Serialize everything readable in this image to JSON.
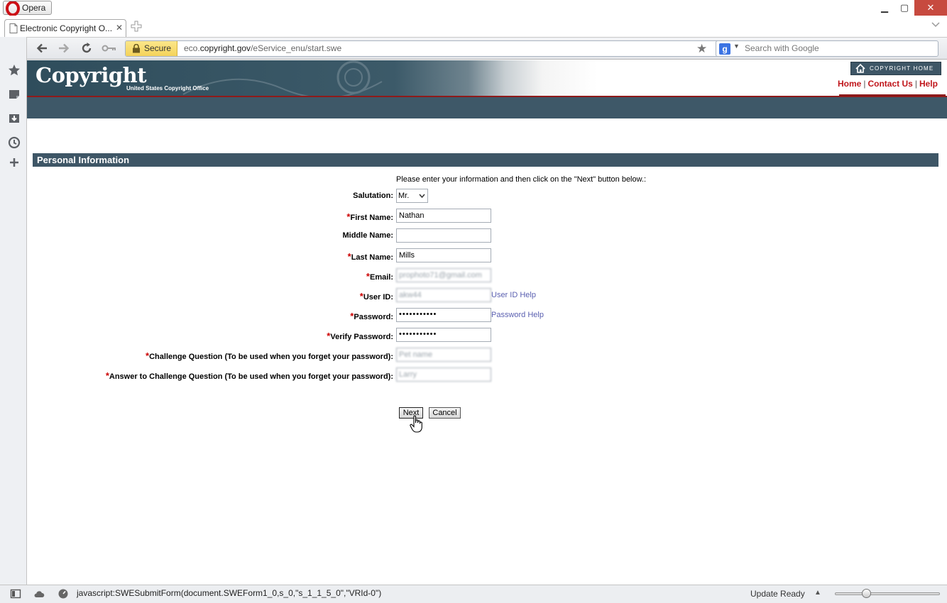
{
  "window": {
    "app_button": "Opera",
    "min": "▁",
    "max": "▢",
    "close": "✕"
  },
  "tab": {
    "title": "Electronic Copyright O...",
    "close": "✕"
  },
  "address_bar": {
    "secure_label": "Secure",
    "url_host_prefix": "eco.",
    "url_host": "copyright.gov",
    "url_path": "/eService_enu/start.swe"
  },
  "search_bar": {
    "placeholder": "Search with Google",
    "engine": "g"
  },
  "banner": {
    "logo_text": "Copyright",
    "logo_subtitle": "United States Copyright Office",
    "home_button": "COPYRIGHT HOME",
    "links": [
      "Home",
      "Contact Us",
      "Help"
    ],
    "link_separator": "|"
  },
  "form": {
    "section_title": "Personal Information",
    "instructions": "Please enter your information and then click on the \"Next\" button below.:",
    "required_mark": "*",
    "fields": {
      "salutation": {
        "label": "Salutation:",
        "value": "Mr."
      },
      "first_name": {
        "label": "First Name:",
        "value": "Nathan"
      },
      "middle_name": {
        "label": "Middle Name:",
        "value": ""
      },
      "last_name": {
        "label": "Last Name:",
        "value": "Mills"
      },
      "email": {
        "label": "Email:",
        "value": "prophoto71@gmail.com"
      },
      "user_id": {
        "label": "User ID:",
        "value": "akw44",
        "help": "User ID Help"
      },
      "password": {
        "label": "Password:",
        "value": "•••••••••••",
        "help": "Password Help"
      },
      "verify_password": {
        "label": "Verify Password:",
        "value": "•••••••••••"
      },
      "challenge_question": {
        "label": "Challenge Question (To be used when you forget your password):",
        "value": "Pet name"
      },
      "challenge_answer": {
        "label": "Answer to Challenge Question (To be used when you forget your password):",
        "value": "Larry"
      }
    },
    "next_button": "Next",
    "cancel_button": "Cancel"
  },
  "statusbar": {
    "link_text": "javascript:SWESubmitForm(document.SWEForm1_0,s_0,\"s_1_1_5_0\",\"VRId-0\")",
    "update_text": "Update Ready",
    "zoom_level": 0.28
  },
  "colors": {
    "banner_dark": "#3e5666",
    "accent_red": "#c0161b",
    "link_blue": "#5a5fb0",
    "window_close": "#c74a3f"
  }
}
